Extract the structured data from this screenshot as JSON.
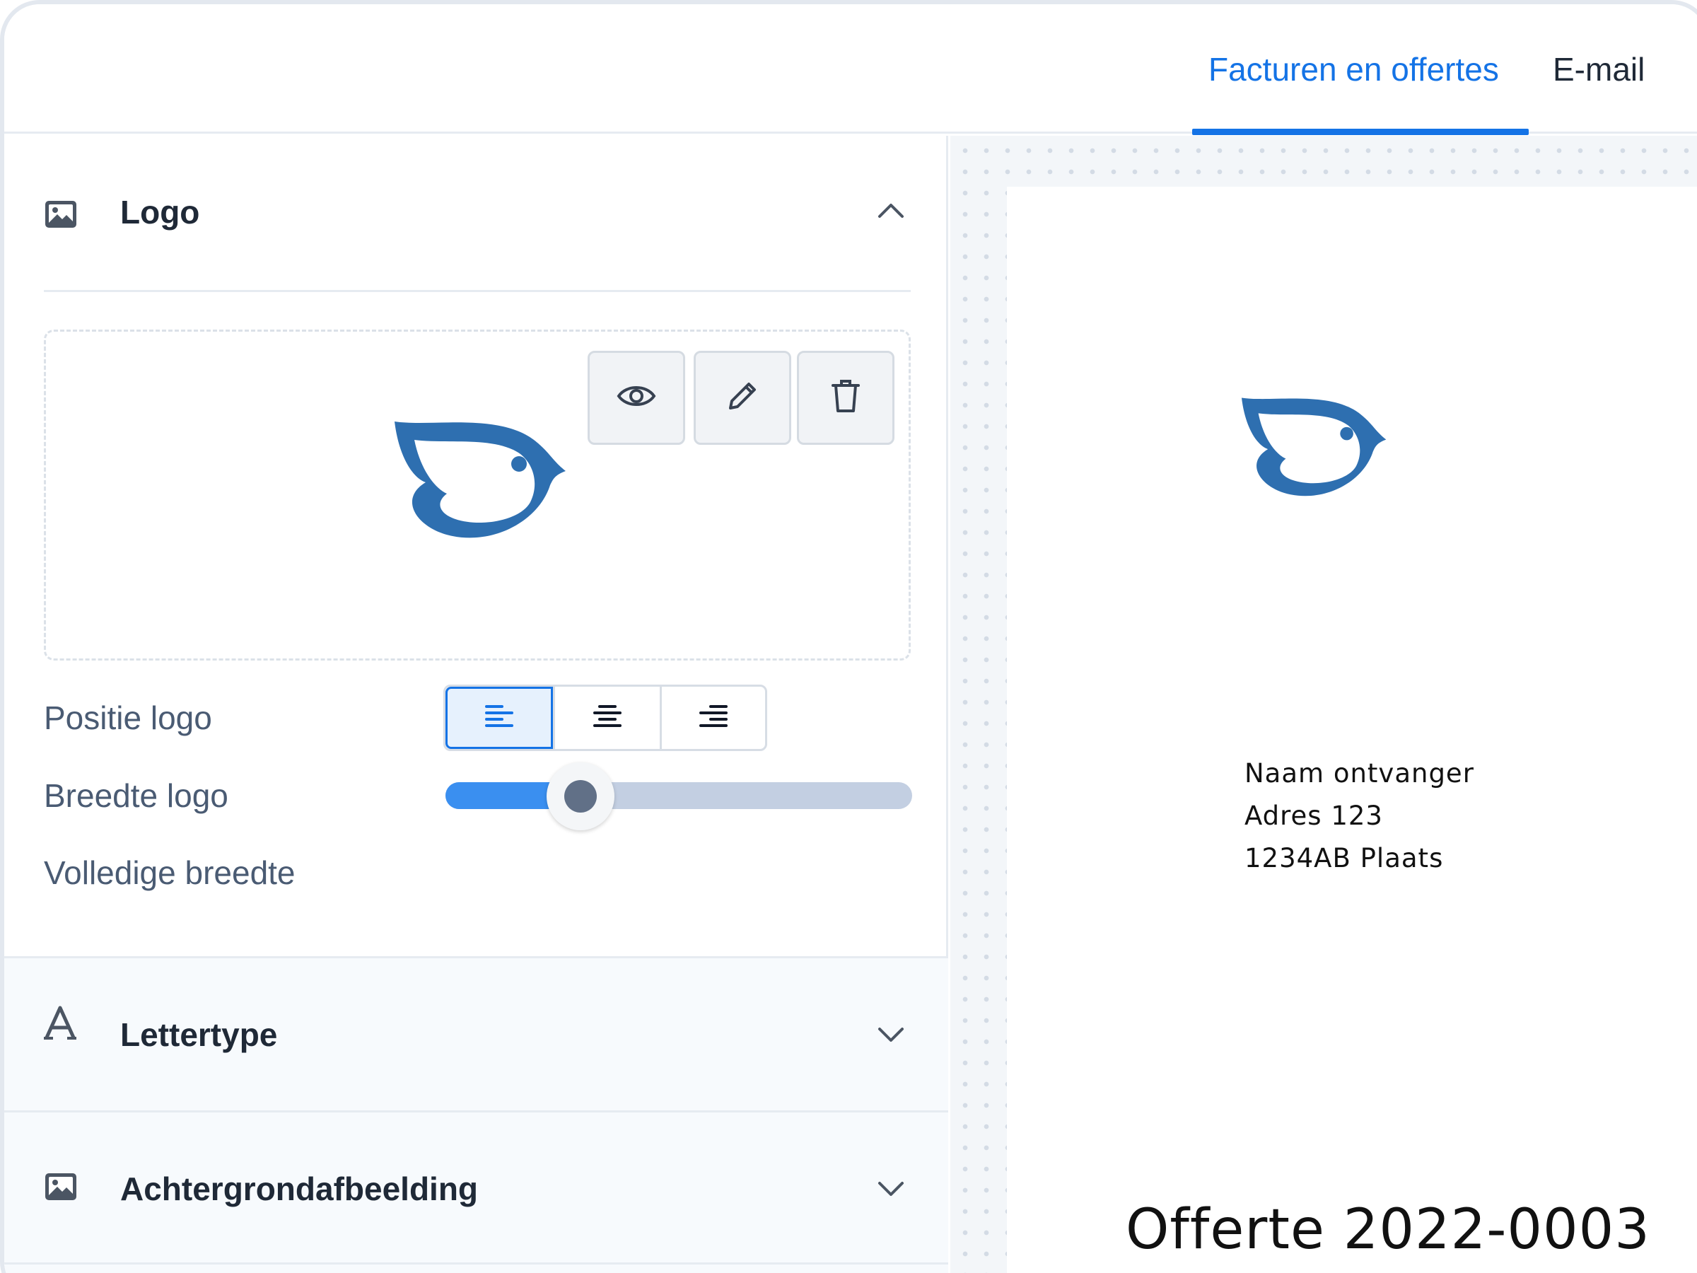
{
  "tabs": [
    {
      "label": "Facturen en offertes",
      "active": true
    },
    {
      "label": "E-mail",
      "active": false
    }
  ],
  "sections": {
    "logo": {
      "title": "Logo",
      "icon": "image-icon",
      "expanded": true,
      "position_label": "Positie logo",
      "position_options": [
        "align-left",
        "align-center",
        "align-right"
      ],
      "position_selected": "align-left",
      "width_label": "Breedte logo",
      "width_value": 0.29,
      "full_width_label": "Volledige breedte",
      "full_width_on": false,
      "actions": [
        "eye-icon",
        "pencil-icon",
        "trash-icon"
      ]
    },
    "font": {
      "title": "Lettertype",
      "icon": "font-icon",
      "expanded": false
    },
    "background": {
      "title": "Achtergrondafbeelding",
      "icon": "image-icon",
      "expanded": false
    }
  },
  "preview": {
    "recipient": [
      "Naam ontvanger",
      "Adres 123",
      "1234AB Plaats"
    ],
    "document_title": "Offerte 2022-0003"
  },
  "colors": {
    "accent": "#1473e6",
    "logo_blue": "#2e6fb0",
    "slider_fill": "#3a8ff0",
    "slider_track": "#c3cfe2"
  }
}
